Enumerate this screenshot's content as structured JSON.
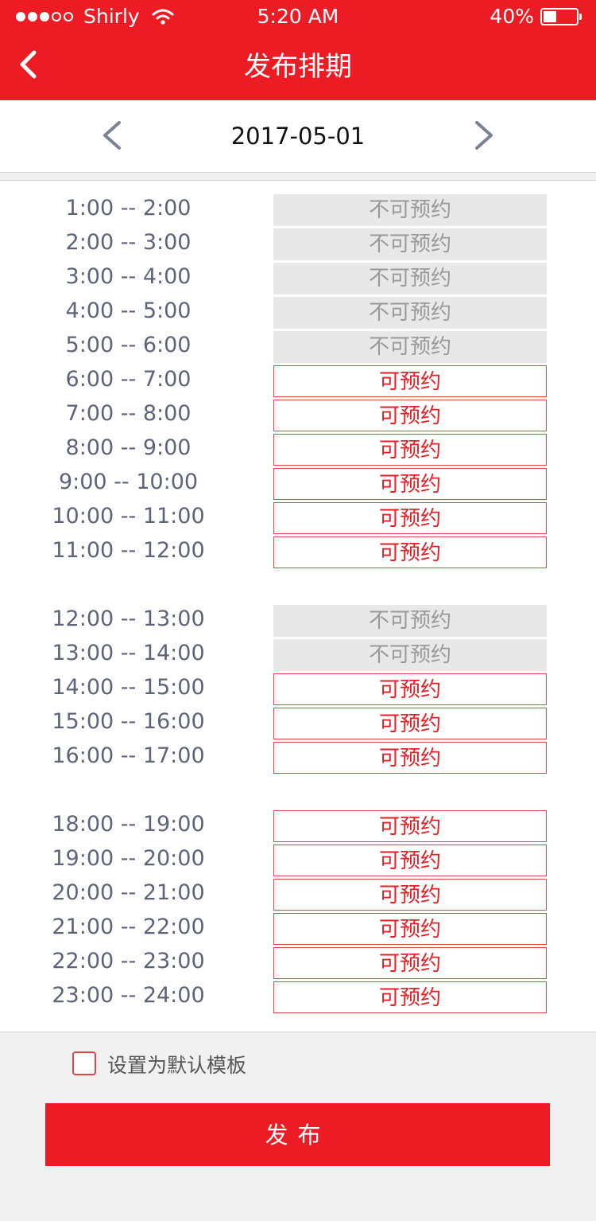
{
  "status_bar": {
    "carrier": "Shirly",
    "time": "5:20 AM",
    "battery_text": "40%",
    "battery_level": 0.4,
    "signal_bars": 3,
    "signal_total": 5
  },
  "header": {
    "title": "发布排期",
    "back_icon": "chevron-left-icon"
  },
  "date_nav": {
    "date": "2017-05-01",
    "prev_icon": "chevron-left-icon",
    "next_icon": "chevron-right-icon"
  },
  "labels": {
    "available": "可预约",
    "unavailable": "不可预约"
  },
  "schedule": {
    "groups": [
      {
        "slots": [
          {
            "time": "1:00 -- 2:00",
            "status": "不可预约",
            "available": false
          },
          {
            "time": "2:00 -- 3:00",
            "status": "不可预约",
            "available": false
          },
          {
            "time": "3:00 -- 4:00",
            "status": "不可预约",
            "available": false
          },
          {
            "time": "4:00 -- 5:00",
            "status": "不可预约",
            "available": false
          },
          {
            "time": "5:00 -- 6:00",
            "status": "不可预约",
            "available": false
          },
          {
            "time": "6:00 -- 7:00",
            "status": "可预约",
            "available": true
          },
          {
            "time": "7:00 -- 8:00",
            "status": "可预约",
            "available": true
          },
          {
            "time": "8:00 -- 9:00",
            "status": "可预约",
            "available": true
          },
          {
            "time": "9:00 -- 10:00",
            "status": "可预约",
            "available": true
          },
          {
            "time": "10:00 -- 11:00",
            "status": "可预约",
            "available": true
          },
          {
            "time": "11:00 -- 12:00",
            "status": "可预约",
            "available": true
          }
        ]
      },
      {
        "slots": [
          {
            "time": "12:00 -- 13:00",
            "status": "不可预约",
            "available": false
          },
          {
            "time": "13:00 -- 14:00",
            "status": "不可预约",
            "available": false
          },
          {
            "time": "14:00 -- 15:00",
            "status": "可预约",
            "available": true
          },
          {
            "time": "15:00 -- 16:00",
            "status": "可预约",
            "available": true
          },
          {
            "time": "16:00 -- 17:00",
            "status": "可预约",
            "available": true
          }
        ]
      },
      {
        "slots": [
          {
            "time": "18:00 -- 19:00",
            "status": "可预约",
            "available": true
          },
          {
            "time": "19:00 -- 20:00",
            "status": "可预约",
            "available": true
          },
          {
            "time": "20:00 -- 21:00",
            "status": "可预约",
            "available": true
          },
          {
            "time": "21:00 -- 22:00",
            "status": "可预约",
            "available": true
          },
          {
            "time": "22:00 -- 23:00",
            "status": "可预约",
            "available": true
          },
          {
            "time": "23:00 -- 24:00",
            "status": "可预约",
            "available": true
          }
        ]
      }
    ]
  },
  "footer": {
    "checkbox_label": "设置为默认模板",
    "checkbox_checked": false,
    "publish_label": "发布"
  },
  "colors": {
    "brand_red": "#ed1c24",
    "available_text": "#e41f26",
    "unavailable_bg": "#e8e8e8",
    "unavailable_text": "#999999",
    "time_text": "#5e6478"
  }
}
